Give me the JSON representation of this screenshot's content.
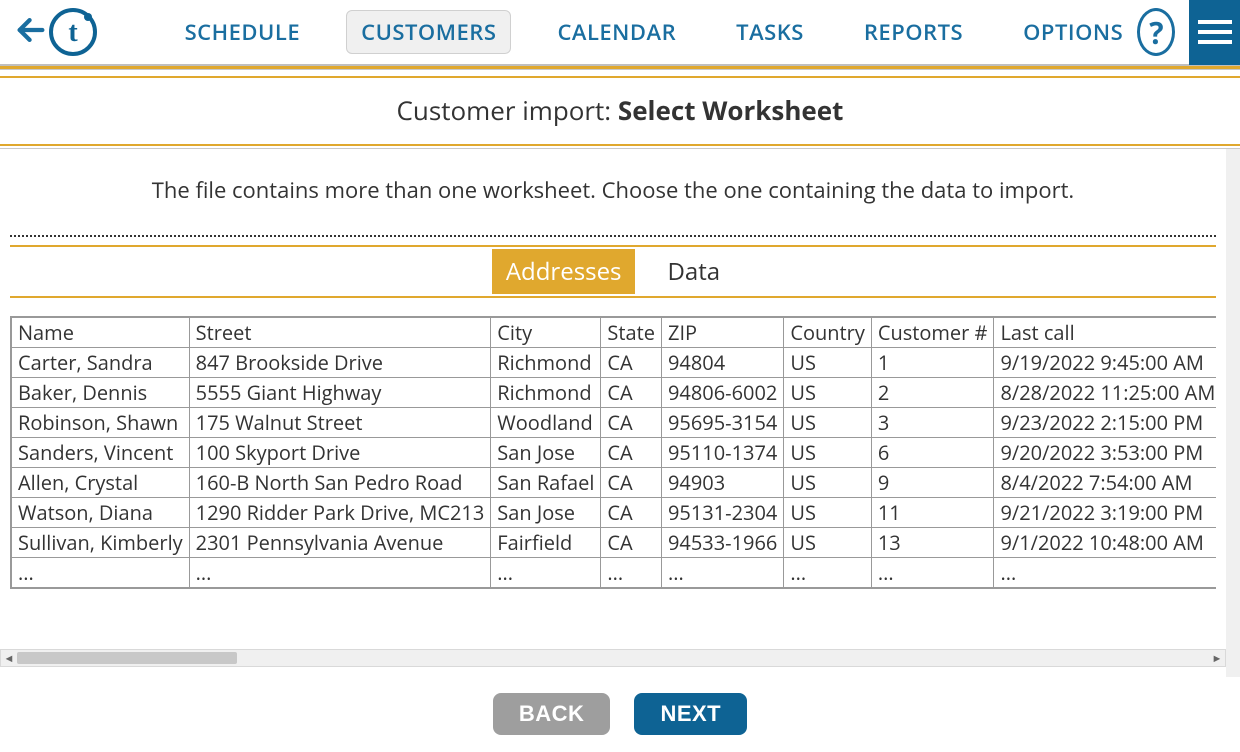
{
  "nav": {
    "items": [
      "SCHEDULE",
      "CUSTOMERS",
      "CALENDAR",
      "TASKS",
      "REPORTS",
      "OPTIONS"
    ],
    "active_index": 1
  },
  "help_glyph": "?",
  "page_title_prefix": "Customer import: ",
  "page_title_bold": "Select Worksheet",
  "instruction": "The file contains more than one worksheet. Choose the one containing the data to import.",
  "worksheet_tabs": {
    "items": [
      "Addresses",
      "Data"
    ],
    "active_index": 0
  },
  "table": {
    "columns": [
      "Name",
      "Street",
      "City",
      "State",
      "ZIP",
      "Country",
      "Customer #",
      "Last call"
    ],
    "rows": [
      [
        "Carter, Sandra",
        "847 Brookside Drive",
        "Richmond",
        "CA",
        "94804",
        "US",
        "1",
        "9/19/2022 9:45:00 AM"
      ],
      [
        "Baker, Dennis",
        "5555 Giant Highway",
        "Richmond",
        "CA",
        "94806-6002",
        "US",
        "2",
        "8/28/2022 11:25:00 AM"
      ],
      [
        "Robinson, Shawn",
        "175 Walnut Street",
        "Woodland",
        "CA",
        "95695-3154",
        "US",
        "3",
        "9/23/2022 2:15:00 PM"
      ],
      [
        "Sanders, Vincent",
        "100 Skyport Drive",
        "San Jose",
        "CA",
        "95110-1374",
        "US",
        "6",
        "9/20/2022 3:53:00 PM"
      ],
      [
        "Allen, Crystal",
        "160-B North San Pedro Road",
        "San Rafael",
        "CA",
        "94903",
        "US",
        "9",
        "8/4/2022 7:54:00 AM"
      ],
      [
        "Watson, Diana",
        "1290 Ridder Park Drive, MC213",
        "San Jose",
        "CA",
        "95131-2304",
        "US",
        "11",
        "9/21/2022 3:19:00 PM"
      ],
      [
        "Sullivan, Kimberly",
        "2301 Pennsylvania Avenue",
        "Fairfield",
        "CA",
        "94533-1966",
        "US",
        "13",
        "9/1/2022 10:48:00 AM"
      ],
      [
        "...",
        "...",
        "...",
        "...",
        "...",
        "...",
        "...",
        "..."
      ]
    ]
  },
  "buttons": {
    "back": "BACK",
    "next": "NEXT"
  }
}
